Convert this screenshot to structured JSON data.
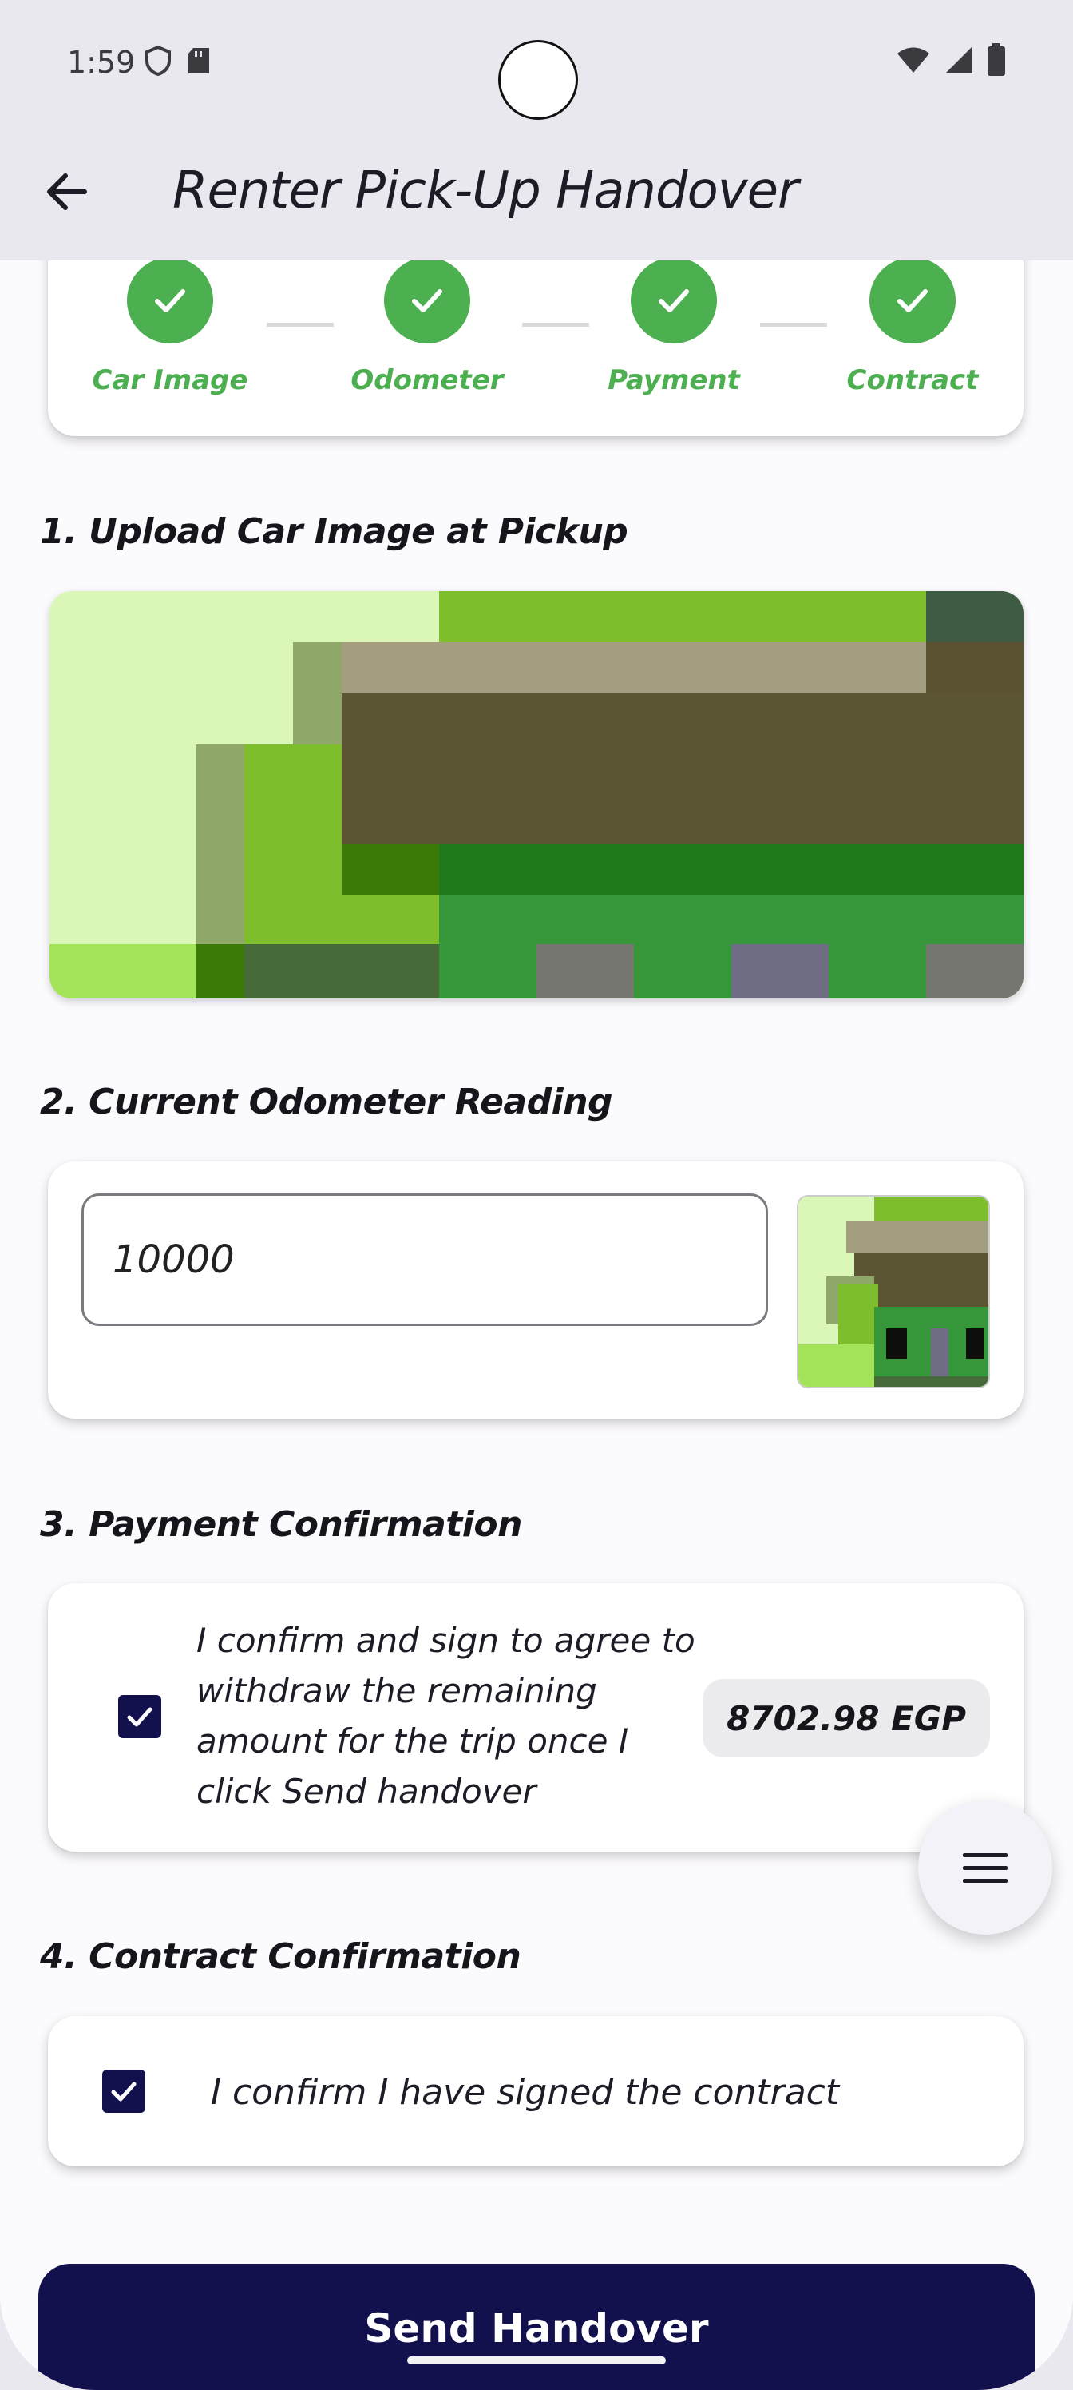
{
  "status_bar": {
    "time": "1:59"
  },
  "app_bar": {
    "title": "Renter Pick-Up Handover"
  },
  "stepper": {
    "steps": [
      {
        "label": "Car Image"
      },
      {
        "label": "Odometer"
      },
      {
        "label": "Payment"
      },
      {
        "label": "Contract"
      }
    ],
    "completed_color": "#4caf50"
  },
  "sections": {
    "car_image": {
      "title": "1. Upload Car Image at Pickup"
    },
    "odometer": {
      "title": "2. Current Odometer Reading",
      "value": "10000"
    },
    "payment": {
      "title": "3. Payment Confirmation",
      "checked": true,
      "text_lines": [
        "I confirm and sign to agree to",
        "withdraw the remaining",
        "amount for the trip once I",
        "click Send handover"
      ],
      "amount": "8702.98 EGP"
    },
    "contract": {
      "title": "4. Contract Confirmation",
      "checked": true,
      "text": "I confirm I have signed the contract"
    }
  },
  "actions": {
    "send_label": "Send Handover",
    "fab_icon": "menu-icon"
  },
  "colors": {
    "primary": "#13104e",
    "success": "#4caf50"
  }
}
